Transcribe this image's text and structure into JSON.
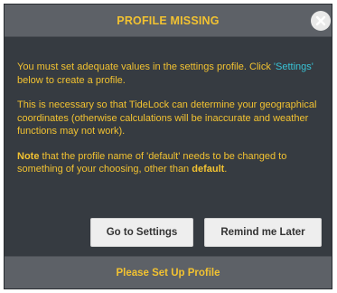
{
  "dialog": {
    "title": "PROFILE MISSING",
    "close_icon": "close-icon",
    "paragraph1": {
      "before": "You must set adequate values in the settings profile. Click ",
      "link": "'Settings'",
      "after": " below to create a profile."
    },
    "paragraph2": "This is necessary so that TideLock can determine your geographical coordinates (otherwise calculations will be inaccurate and weather functions may not work).",
    "paragraph3": {
      "note_label": "Note",
      "text1": " that the profile name of '",
      "default_quoted": "default",
      "text2": "' needs to be changed to something of your choosing, other than ",
      "default_bold": "default",
      "text3": "."
    },
    "buttons": {
      "settings": "Go to Settings",
      "remind": "Remind me Later"
    },
    "footer": "Please Set Up Profile"
  },
  "colors": {
    "panel": "#363b41",
    "header": "#5d6167",
    "text": "#f2c231",
    "link": "#39c3d6",
    "button": "#eeeeee"
  }
}
